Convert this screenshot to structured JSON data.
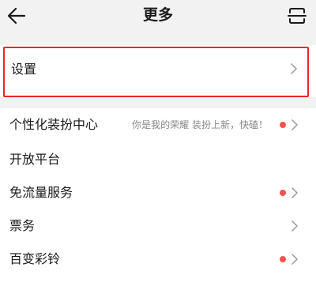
{
  "header": {
    "title": "更多",
    "back_icon": "arrow-left-icon",
    "scan_icon": "scan-icon"
  },
  "settings": {
    "label": "设置",
    "highlight_color": "#e22b2b"
  },
  "menu": {
    "items": [
      {
        "label": "个性化装扮中心",
        "hint": "你是我的荣耀 装扮上新，快磕！",
        "has_dot": true
      },
      {
        "label": "开放平台",
        "hint": "",
        "has_dot": false
      },
      {
        "label": "免流量服务",
        "hint": "",
        "has_dot": true
      },
      {
        "label": "票务",
        "hint": "",
        "has_dot": false
      },
      {
        "label": "百变彩铃",
        "hint": "",
        "has_dot": true
      }
    ]
  },
  "colors": {
    "dot": "#ef5350",
    "background": "#f2f2f2",
    "card": "#ffffff",
    "hint": "#888888"
  }
}
